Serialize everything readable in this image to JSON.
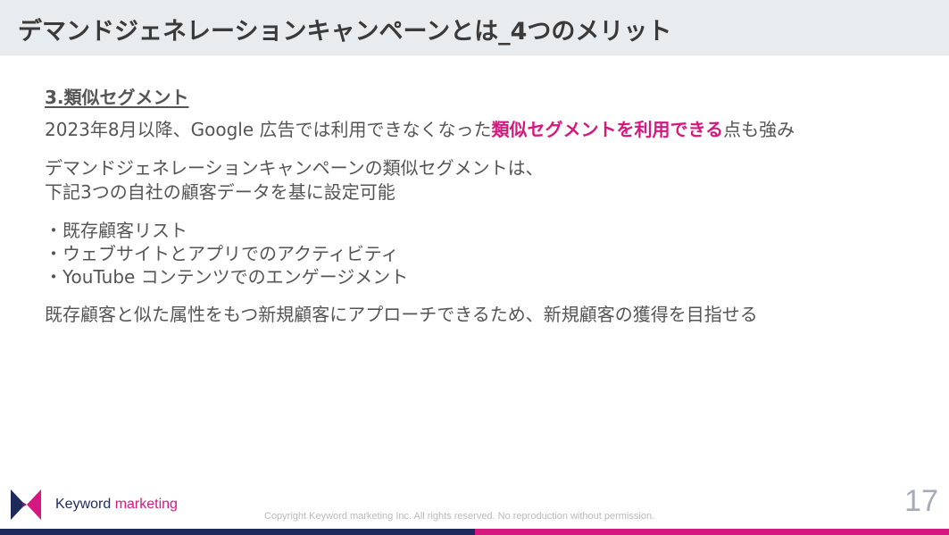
{
  "header": {
    "title": "デマンドジェネレーションキャンペーンとは_4つのメリット"
  },
  "section": {
    "heading": "3.類似セグメント",
    "intro_before": "2023年8月以降、Google 広告では利用できなくなった",
    "intro_highlight": "類似セグメントを利用できる",
    "intro_after": "点も強み",
    "desc_line1": "デマンドジェネレーションキャンペーンの類似セグメントは、",
    "desc_line2": "下記3つの自社の顧客データを基に設定可能",
    "bullets": [
      "・既存顧客リスト",
      "・ウェブサイトとアプリでのアクティビティ",
      "・YouTube コンテンツでのエンゲージメント"
    ],
    "conclusion": "既存顧客と似た属性をもつ新規顧客にアプローチできるため、新規顧客の獲得を目指せる"
  },
  "footer": {
    "logo_word1": "Keyword",
    "logo_word2": " marketing",
    "copyright": "Copyright Keyword marketing Inc. All rights reserved. No reproduction without permission.",
    "page_number": "17"
  },
  "colors": {
    "accent_pink": "#d6177f",
    "brand_navy": "#1f2a5c",
    "header_bg": "#e9ecee",
    "body_text": "#555555"
  }
}
